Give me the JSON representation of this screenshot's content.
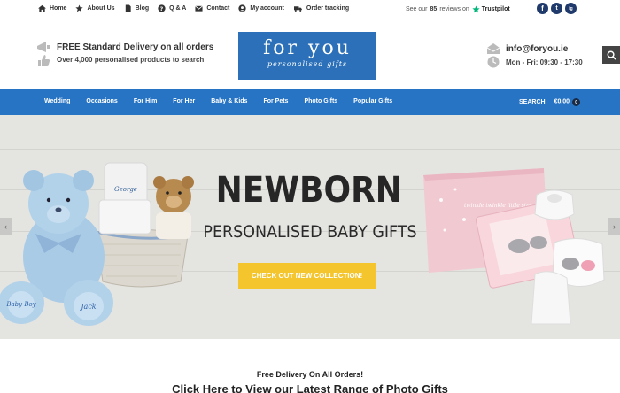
{
  "topbar": {
    "links": [
      "Home",
      "About Us",
      "Blog",
      "Q & A",
      "Contact",
      "My account",
      "Order tracking"
    ],
    "reviews_prefix": "See our",
    "reviews_count": "85",
    "reviews_suffix": "reviews on",
    "trustpilot": "Trustpilot",
    "social": [
      "f",
      "t",
      "ig"
    ]
  },
  "header": {
    "delivery_title": "FREE Standard Delivery on all orders",
    "delivery_sub": "Over 4,000 personalised products to search",
    "logo_main": "for you",
    "logo_sub": "personalised gifts",
    "email": "info@foryou.ie",
    "hours": "Mon - Fri: 09:30 - 17:30"
  },
  "nav": {
    "items": [
      "Wedding",
      "Occasions",
      "For Him",
      "For Her",
      "Baby & Kids",
      "For Pets",
      "Photo Gifts",
      "Popular Gifts"
    ],
    "search": "SEARCH",
    "cart": "€0.00",
    "cart_count": "0"
  },
  "hero": {
    "headline": "NEWBORN",
    "subheadline": "PERSONALISED BABY GIFTS",
    "cta": "CHECK OUT NEW COLLECTION!",
    "teddy_text": "Baby Boy",
    "teddy_name": "Jack",
    "basket_name": "George",
    "book_text": "twinkle twinkle little star"
  },
  "promo": {
    "free_delivery": "Free Delivery On All Orders!",
    "photo_gifts": "Click Here to View our Latest Range of Photo Gifts"
  },
  "colors": {
    "brand_blue": "#2774c5",
    "logo_blue": "#2b70b8",
    "cta_yellow": "#f4c52c"
  }
}
